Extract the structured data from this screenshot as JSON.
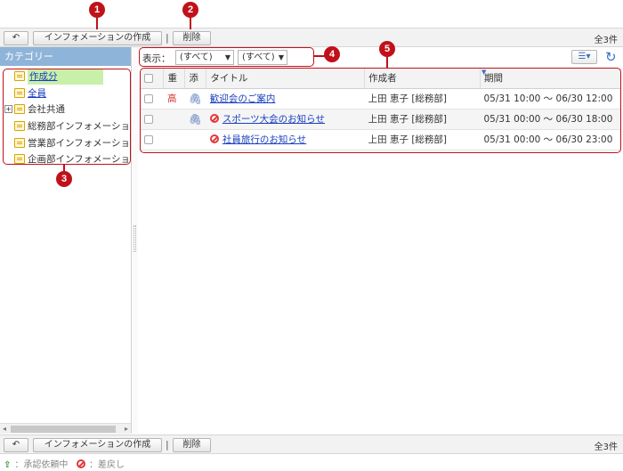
{
  "toolbar": {
    "back_icon": "back-arrow-icon",
    "create_label": "インフォメーションの作成",
    "separator": "|",
    "delete_label": "削除",
    "count": "全3件"
  },
  "callouts": [
    "1",
    "2",
    "3",
    "4",
    "5"
  ],
  "sidebar": {
    "header": "カテゴリー",
    "items": [
      {
        "label": "作成分",
        "link": true,
        "selected": true
      },
      {
        "label": "全員",
        "link": true,
        "selected": false
      },
      {
        "label": "会社共通",
        "link": false,
        "expander": "+"
      },
      {
        "label": "総務部インフォメーション",
        "link": false
      },
      {
        "label": "営業部インフォメーション",
        "link": false
      },
      {
        "label": "企画部インフォメーション",
        "link": false
      }
    ]
  },
  "filter": {
    "label": "表示：",
    "select1": "(すべて)",
    "select2": "(すべて)"
  },
  "table": {
    "headers": [
      "重",
      "添",
      "タイトル",
      "作成者",
      "期間"
    ],
    "rows": [
      {
        "priority": "高",
        "attach": true,
        "status": "",
        "title": "歓迎会のご案内",
        "author": "上田 恵子 [総務部]",
        "period": "05/31 10:00 ～ 06/30 12:00"
      },
      {
        "priority": "",
        "attach": true,
        "status": "rejected",
        "title": "スポーツ大会のお知らせ",
        "author": "上田 恵子 [総務部]",
        "period": "05/31 00:00 ～ 06/30 18:00"
      },
      {
        "priority": "",
        "attach": false,
        "status": "rejected",
        "title": "社員旅行のお知らせ",
        "author": "上田 恵子 [総務部]",
        "period": "05/31 00:00 ～ 06/30 23:00"
      }
    ]
  },
  "legend": {
    "pending": "：承認依頼中",
    "rejected": "：差戻し"
  },
  "colors": {
    "accent": "#c0111a",
    "sidebar_header": "#8fb4d9",
    "selected": "#c9f0a8",
    "link": "#1a3fbf"
  }
}
